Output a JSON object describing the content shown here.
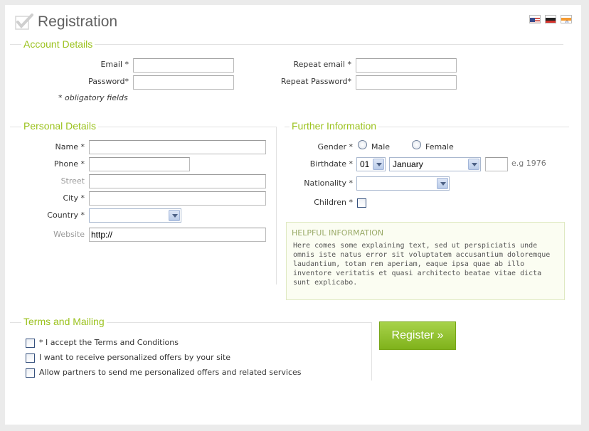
{
  "header": {
    "title": "Registration"
  },
  "language_flags": [
    "us-flag-icon",
    "de-flag-icon",
    "in-flag-icon"
  ],
  "colors": {
    "accent": "#9bc21e",
    "button": "#8cc22a",
    "help_bg": "#fbfdf2"
  },
  "account": {
    "legend": "Account Details",
    "email_label": "Email *",
    "repeat_email_label": "Repeat email *",
    "password_label": "Password*",
    "repeat_password_label": "Repeat Password*",
    "obligatory_note": "* obligatory fields"
  },
  "personal": {
    "legend": "Personal Details",
    "name_label": "Name *",
    "phone_label": "Phone *",
    "street_label": "Street",
    "city_label": "City *",
    "country_label": "Country *",
    "website_label": "Website",
    "website_value": "http://"
  },
  "further": {
    "legend": "Further Information",
    "gender_label": "Gender *",
    "male_label": "Male",
    "female_label": "Female",
    "birthdate_label": "Birthdate *",
    "day_value": "01",
    "month_value": "January",
    "year_hint": "e.g 1976",
    "nationality_label": "Nationality *",
    "children_label": "Children *"
  },
  "help": {
    "title": "HELPFUL INFORMATION",
    "text": "Here comes some explaining text, sed ut perspiciatis unde omnis iste natus error sit voluptatem accusantium doloremque laudantium, totam rem aperiam, eaque ipsa quae ab illo inventore veritatis et quasi architecto beatae vitae dicta sunt explicabo."
  },
  "terms": {
    "legend": "Terms and Mailing",
    "accept_label": "* I accept the Terms and Conditions",
    "offers_label": "I want to receive personalized offers by your site",
    "partners_label": "Allow partners to send me personalized offers and related services"
  },
  "register_label": "Register »"
}
